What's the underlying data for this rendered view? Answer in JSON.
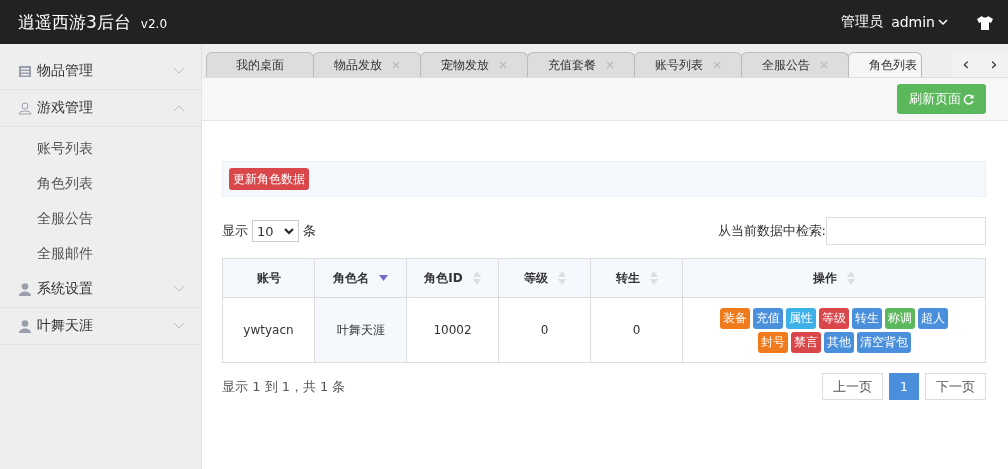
{
  "header": {
    "title": "逍遥西游3后台",
    "version": "v2.0",
    "role": "管理员",
    "user": "admin"
  },
  "sidebar": {
    "items": [
      {
        "label": "物品管理",
        "expanded": false
      },
      {
        "label": "游戏管理",
        "expanded": true,
        "children": [
          {
            "label": "账号列表"
          },
          {
            "label": "角色列表"
          },
          {
            "label": "全服公告"
          },
          {
            "label": "全服邮件"
          }
        ]
      },
      {
        "label": "系统设置",
        "expanded": false
      },
      {
        "label": "叶舞天涯",
        "expanded": false
      }
    ]
  },
  "tabs": [
    {
      "label": "我的桌面",
      "closable": false,
      "selected": false
    },
    {
      "label": "物品发放",
      "closable": true,
      "selected": false
    },
    {
      "label": "宠物发放",
      "closable": true,
      "selected": false
    },
    {
      "label": "充值套餐",
      "closable": true,
      "selected": false
    },
    {
      "label": "账号列表",
      "closable": true,
      "selected": false
    },
    {
      "label": "全服公告",
      "closable": true,
      "selected": false
    },
    {
      "label": "角色列表",
      "closable": false,
      "selected": true
    }
  ],
  "tab_nav": {
    "prev": "‹",
    "next": "›"
  },
  "refresh_button": "刷新页面",
  "update_button": "更新角色数据",
  "page_size": {
    "prefix": "显示",
    "value": "10",
    "suffix": "条"
  },
  "search": {
    "label": "从当前数据中检索:"
  },
  "table": {
    "columns": [
      {
        "label": "账号",
        "sortable": false,
        "sorted": false
      },
      {
        "label": "角色名",
        "sortable": true,
        "sorted": true
      },
      {
        "label": "角色ID",
        "sortable": true,
        "sorted": false
      },
      {
        "label": "等级",
        "sortable": true,
        "sorted": false
      },
      {
        "label": "转生",
        "sortable": true,
        "sorted": false
      },
      {
        "label": "操作",
        "sortable": true,
        "sorted": false
      }
    ],
    "rows": [
      {
        "cells": [
          "ywtyacn",
          "叶舞天涯",
          "10002",
          "0",
          "0"
        ],
        "actions": [
          {
            "label": "装备",
            "color": "#f07b1d"
          },
          {
            "label": "充值",
            "color": "#4a8fdc"
          },
          {
            "label": "属性",
            "color": "#3cb1e8"
          },
          {
            "label": "等级",
            "color": "#d9474b"
          },
          {
            "label": "转生",
            "color": "#4a8fdc"
          },
          {
            "label": "称调",
            "color": "#5cb85c"
          },
          {
            "label": "超人",
            "color": "#4a8fdc"
          },
          {
            "label": "封号",
            "color": "#f07b1d"
          },
          {
            "label": "禁言",
            "color": "#d9474b"
          },
          {
            "label": "其他",
            "color": "#4a8fdc"
          },
          {
            "label": "清空背包",
            "color": "#4a8fdc"
          }
        ]
      }
    ]
  },
  "info": "显示 1 到 1，共 1 条",
  "pagination": [
    {
      "label": "上一页",
      "selected": false
    },
    {
      "label": "1",
      "selected": true
    },
    {
      "label": "下一页",
      "selected": false
    }
  ]
}
